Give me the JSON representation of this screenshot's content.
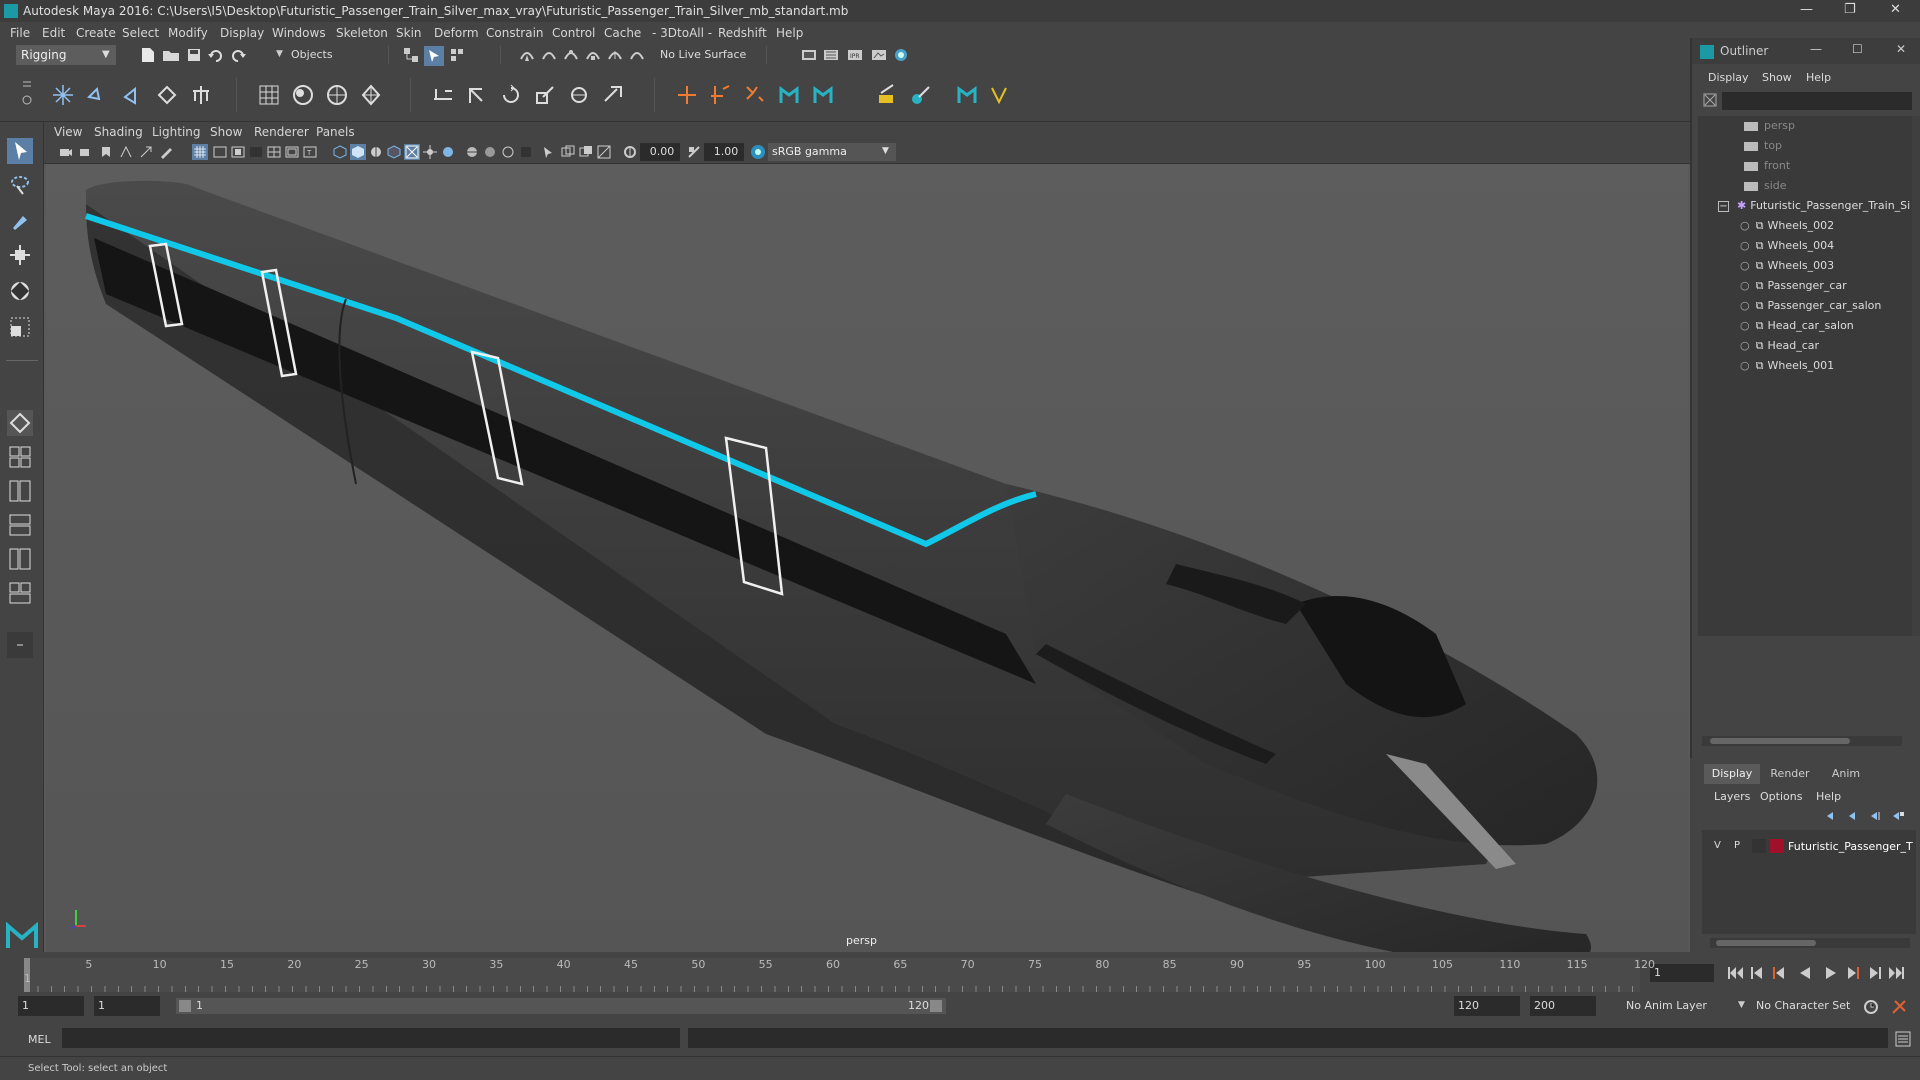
{
  "window": {
    "title": "Autodesk Maya 2016: C:\\Users\\I5\\Desktop\\Futuristic_Passenger_Train_Silver_max_vray\\Futuristic_Passenger_Train_Silver_mb_standart.mb",
    "controls": [
      "—",
      "❐",
      "✕"
    ]
  },
  "menubar": [
    "File",
    "Edit",
    "Create",
    "Select",
    "Modify",
    "Display",
    "Windows",
    "Skeleton",
    "Skin",
    "Deform",
    "Constrain",
    "Control",
    "Cache",
    "- 3DtoAll -",
    "Redshift",
    "Help"
  ],
  "statusline": {
    "mode": "Rigging",
    "selection_mask": "Objects",
    "live_surface": "No Live Surface"
  },
  "viewport": {
    "menus": [
      "View",
      "Shading",
      "Lighting",
      "Show",
      "Renderer",
      "Panels"
    ],
    "exposure": "0.00",
    "gamma": "1.00",
    "color_space": "sRGB gamma",
    "camera_label": "persp",
    "accent": "#12c8e8"
  },
  "outliner": {
    "title": "Outliner",
    "menus": [
      "Display",
      "Show",
      "Help"
    ],
    "cameras": [
      "persp",
      "top",
      "front",
      "side"
    ],
    "root": "Futuristic_Passenger_Train_Si",
    "children": [
      "Wheels_002",
      "Wheels_004",
      "Wheels_003",
      "Passenger_car",
      "Passenger_car_salon",
      "Head_car_salon",
      "Head_car",
      "Wheels_001"
    ]
  },
  "layer_editor": {
    "tabs": [
      "Display",
      "Render",
      "Anim"
    ],
    "menus": [
      "Layers",
      "Options",
      "Help"
    ],
    "layer": {
      "v": "V",
      "p": "P",
      "name": "Futuristic_Passenger_T",
      "color": "#a0102a"
    }
  },
  "timeline": {
    "ticks": [
      "5",
      "10",
      "15",
      "20",
      "25",
      "30",
      "35",
      "40",
      "45",
      "50",
      "55",
      "60",
      "65",
      "70",
      "75",
      "80",
      "85",
      "90",
      "95",
      "100",
      "105",
      "110",
      "115",
      "120"
    ],
    "current_frame": "1",
    "first_tick": "1"
  },
  "range": {
    "start": "1",
    "playback_start": "1",
    "slider_start": "1",
    "slider_end": "120",
    "playback_end": "120",
    "end": "200",
    "anim_layer": "No Anim Layer",
    "character_set": "No Character Set"
  },
  "command": {
    "label": "MEL"
  },
  "help_line": "Select Tool: select an object"
}
